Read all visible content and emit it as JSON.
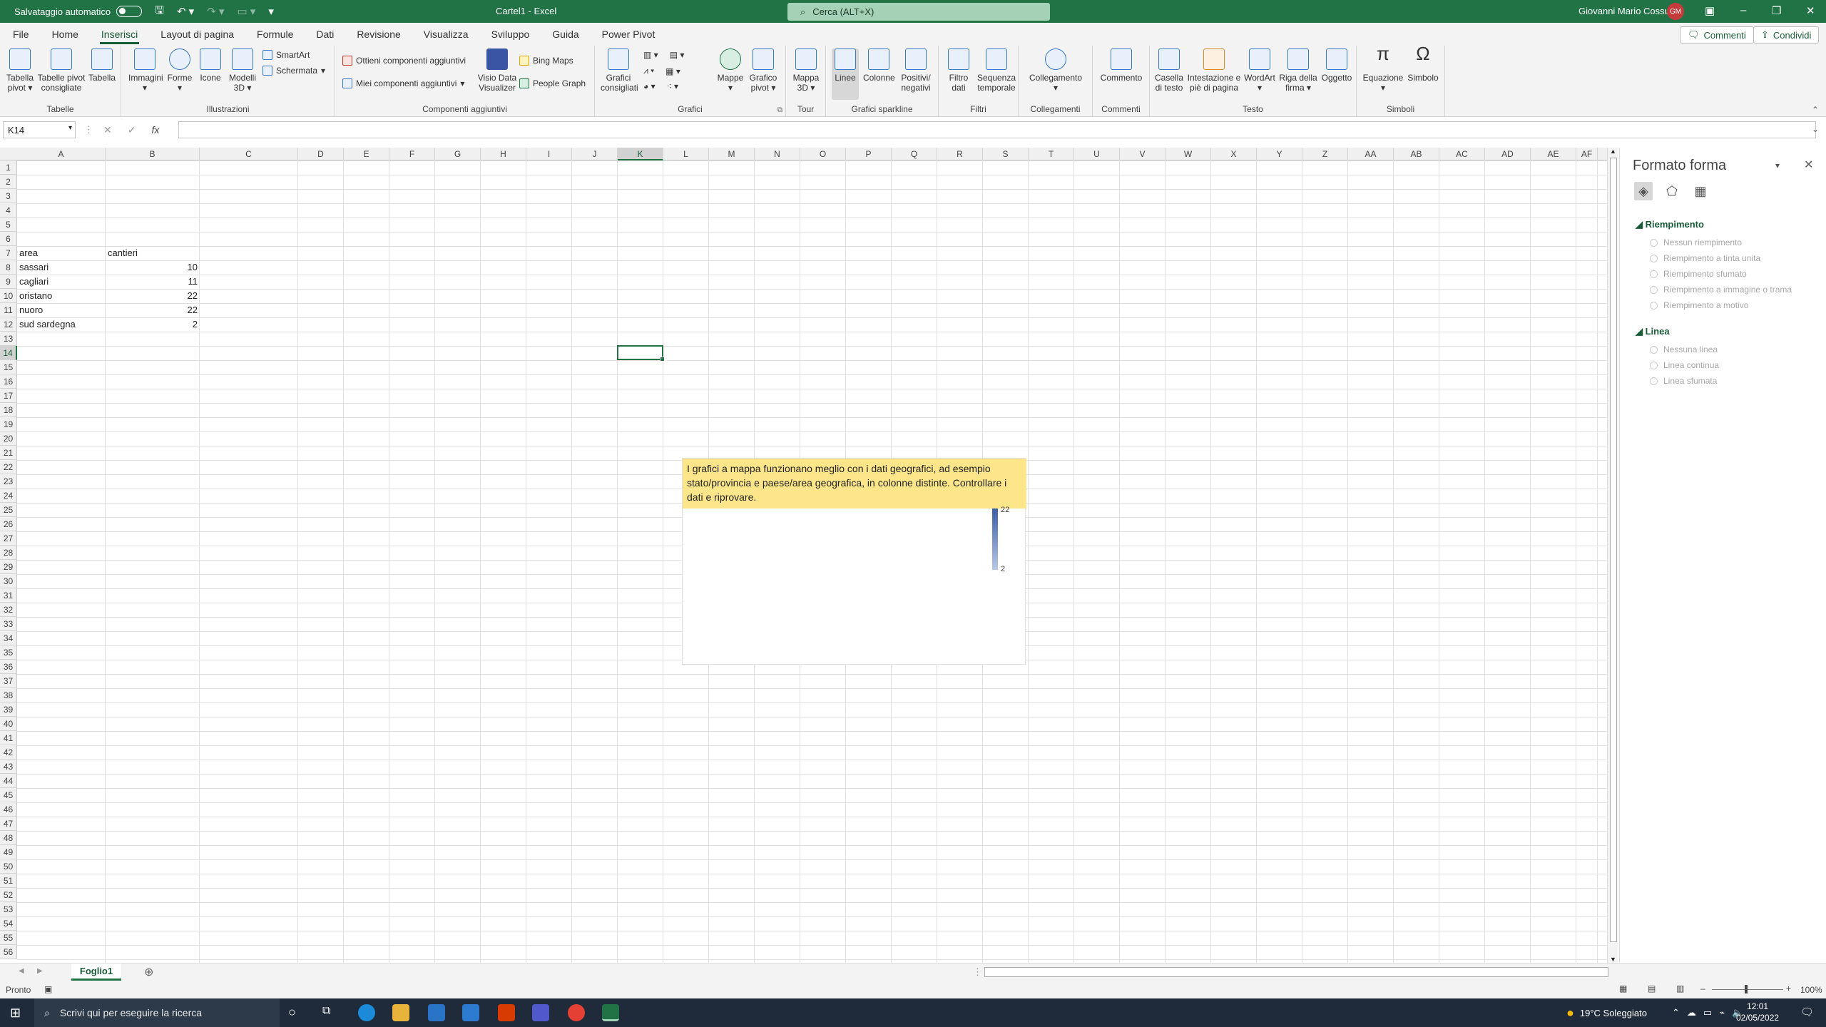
{
  "titlebar": {
    "autosave_label": "Salvataggio automatico",
    "doc_title": "Cartel1  -  Excel",
    "search_placeholder": "Cerca (ALT+X)",
    "user_name": "Giovanni Mario Cossu",
    "user_initials": "GM"
  },
  "menu": {
    "tabs": [
      "File",
      "Home",
      "Inserisci",
      "Layout di pagina",
      "Formule",
      "Dati",
      "Revisione",
      "Visualizza",
      "Sviluppo",
      "Guida",
      "Power Pivot"
    ],
    "active": "Inserisci",
    "comments_label": "Commenti",
    "share_label": "Condividi"
  },
  "ribbon": {
    "tabelle": {
      "label": "Tabelle",
      "pivot": "Tabella pivot",
      "pivot_sugg": "Tabelle pivot consigliate",
      "tabella": "Tabella"
    },
    "illustrazioni": {
      "label": "Illustrazioni",
      "immagini": "Immagini",
      "forme": "Forme",
      "icone": "Icone",
      "modelli3d": "Modelli 3D",
      "smartart": "SmartArt",
      "schermata": "Schermata"
    },
    "componenti": {
      "label": "Componenti aggiuntivi",
      "ottieni": "Ottieni componenti aggiuntivi",
      "miei": "Miei componenti aggiuntivi",
      "visio": "Visio Data Visualizer",
      "bing": "Bing Maps",
      "people": "People Graph"
    },
    "grafici": {
      "label": "Grafici",
      "consigliati": "Grafici consigliati",
      "mappe": "Mappe",
      "pivot": "Grafico pivot"
    },
    "tour": {
      "label": "Tour",
      "mappa3d": "Mappa 3D"
    },
    "sparkline": {
      "label": "Grafici sparkline",
      "linee": "Linee",
      "colonne": "Colonne",
      "positivi": "Positivi/ negativi"
    },
    "filtri": {
      "label": "Filtri",
      "filtro": "Filtro dati",
      "sequenza": "Sequenza temporale"
    },
    "collegamenti": {
      "label": "Collegamenti",
      "collegamento": "Collegamento"
    },
    "commenti": {
      "label": "Commenti",
      "commento": "Commento"
    },
    "testo": {
      "label": "Testo",
      "casella": "Casella di testo",
      "intestazione": "Intestazione e piè di pagina",
      "wordart": "WordArt",
      "riga": "Riga della firma",
      "oggetto": "Oggetto"
    },
    "simboli": {
      "label": "Simboli",
      "equazione": "Equazione",
      "simbolo": "Simbolo"
    }
  },
  "formula": {
    "namebox": "K14",
    "x": "✕",
    "check": "✓",
    "fx": "fx"
  },
  "columns": [
    "A",
    "B",
    "C",
    "D",
    "E",
    "F",
    "G",
    "H",
    "I",
    "J",
    "K",
    "L",
    "M",
    "N",
    "O",
    "P",
    "Q",
    "R",
    "S",
    "T",
    "U",
    "V",
    "W",
    "X",
    "Y",
    "Z",
    "AA",
    "AB",
    "AC",
    "AD",
    "AE",
    "AF"
  ],
  "rows_count": 56,
  "selected": {
    "col": "K",
    "row": 14
  },
  "table": {
    "headers": [
      "area",
      "cantieri"
    ],
    "rows": [
      [
        "sassari",
        10
      ],
      [
        "cagliari",
        11
      ],
      [
        "oristano",
        22
      ],
      [
        "nuoro",
        22
      ],
      [
        "sud sardegna",
        2
      ]
    ]
  },
  "chart": {
    "message": "I grafici a mappa funzionano meglio con i dati geografici, ad esempio stato/provincia e paese/area geografica, in colonne distinte. Controllare i dati e riprovare.",
    "legend_max": "22",
    "legend_min": "2",
    "legend_colors": [
      "#3b5ea8",
      "#b7c7e8"
    ]
  },
  "pane": {
    "title": "Formato forma",
    "fill_section": "Riempimento",
    "fill_options": [
      "Nessun riempimento",
      "Riempimento a tinta unita",
      "Riempimento sfumato",
      "Riempimento a immagine o trama",
      "Riempimento a motivo"
    ],
    "line_section": "Linea",
    "line_options": [
      "Nessuna linea",
      "Linea continua",
      "Linea sfumata"
    ]
  },
  "sheet": {
    "tab": "Foglio1"
  },
  "status": {
    "text": "Pronto",
    "zoom": "100%"
  },
  "taskbar": {
    "search_placeholder": "Scrivi qui per eseguire la ricerca",
    "weather": "19°C  Soleggiato",
    "time": "12:01",
    "date": "02/05/2022"
  },
  "accent": "#217346"
}
